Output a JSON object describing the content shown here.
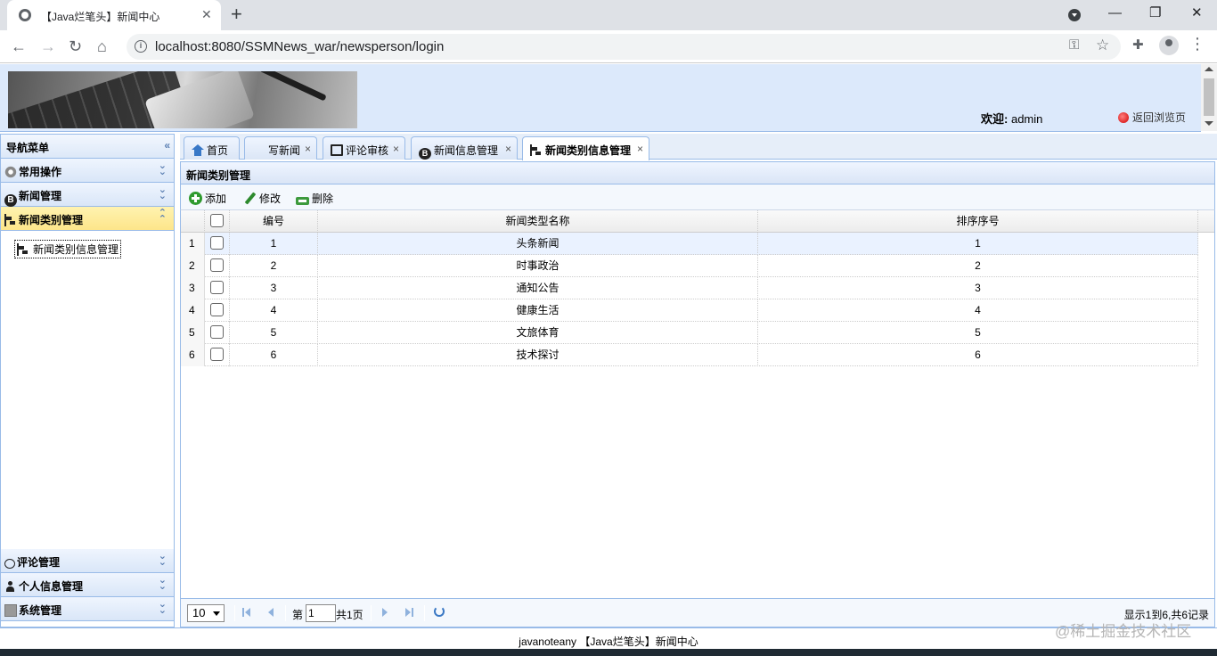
{
  "browser": {
    "tab_title": "【Java烂笔头】新闻中心",
    "tab_close": "✕",
    "new_tab": "+",
    "url": "localhost:8080/SSMNews_war/newsperson/login",
    "window_minimize": "—",
    "window_restore": "❐",
    "window_close": "✕"
  },
  "header": {
    "welcome_label": "欢迎:",
    "username": "admin",
    "back_link": "返回浏览页"
  },
  "sidebar": {
    "title": "导航菜单",
    "collapse": "«",
    "sections": [
      {
        "label": "常用操作",
        "icon": "gear-icon"
      },
      {
        "label": "新闻管理",
        "icon": "blogger-icon"
      },
      {
        "label": "新闻类别管理",
        "icon": "tree-icon",
        "expanded": true
      },
      {
        "label": "评论管理",
        "icon": "comment-icon"
      },
      {
        "label": "个人信息管理",
        "icon": "user-icon"
      },
      {
        "label": "系统管理",
        "icon": "system-icon"
      }
    ],
    "active_item": "新闻类别信息管理"
  },
  "tabs": [
    {
      "label": "首页",
      "icon": "home-icon",
      "closable": false
    },
    {
      "label": "写新闻",
      "closable": true
    },
    {
      "label": "评论审核",
      "icon": "monitor-icon",
      "closable": true
    },
    {
      "label": "新闻信息管理",
      "icon": "blogger-icon",
      "closable": true
    },
    {
      "label": "新闻类别信息管理",
      "icon": "tree-icon",
      "closable": true,
      "selected": true
    }
  ],
  "tab_close": "×",
  "panel": {
    "title": "新闻类别管理",
    "toolbar": {
      "add": "添加",
      "edit": "修改",
      "delete": "删除"
    }
  },
  "table": {
    "columns": [
      "编号",
      "新闻类型名称",
      "排序序号"
    ],
    "rows": [
      {
        "rownum": "1",
        "id": "1",
        "name": "头条新闻",
        "order": "1"
      },
      {
        "rownum": "2",
        "id": "2",
        "name": "时事政治",
        "order": "2"
      },
      {
        "rownum": "3",
        "id": "3",
        "name": "通知公告",
        "order": "3"
      },
      {
        "rownum": "4",
        "id": "4",
        "name": "健康生活",
        "order": "4"
      },
      {
        "rownum": "5",
        "id": "5",
        "name": "文旅体育",
        "order": "5"
      },
      {
        "rownum": "6",
        "id": "6",
        "name": "技术探讨",
        "order": "6"
      }
    ]
  },
  "pager": {
    "page_size": "10",
    "page_prefix": "第",
    "page_value": "1",
    "page_suffix": "共1页",
    "info": "显示1到6,共6记录"
  },
  "footer": "javanoteany 【Java烂笔头】新闻中心",
  "watermark": "@稀土掘金技术社区",
  "colors": {
    "accent": "#99bbe8",
    "active_section": "#fde58a",
    "header_bg": "#dce9fb"
  }
}
